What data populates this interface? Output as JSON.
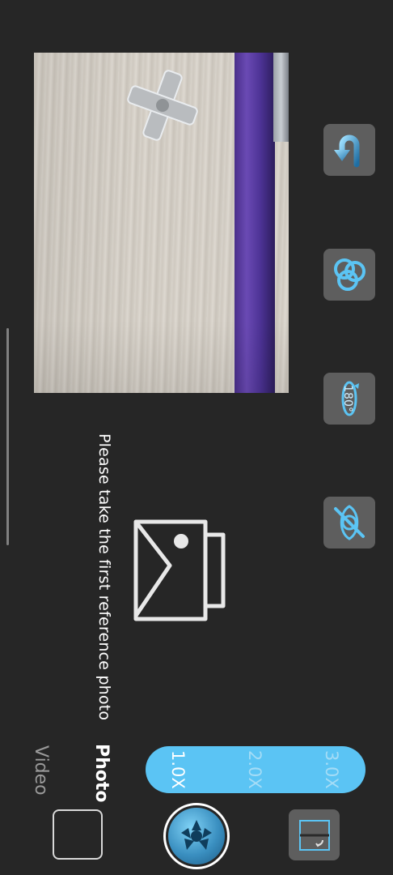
{
  "hint": {
    "text": "Please take the first reference photo"
  },
  "modes": {
    "photo": "Photo",
    "video": "Video"
  },
  "zoom": {
    "options": [
      "1.0X",
      "2.0X",
      "3.0X"
    ],
    "selected": "1.0X"
  },
  "icons": {
    "undo": "u-turn-arrow-icon",
    "filters": "overlapping-circles-icon",
    "rotate": "rotate-180-icon",
    "visibility": "eye-off-icon",
    "placeholder": "image-stack-icon",
    "shutter": "aperture-icon",
    "switch": "split-view-icon"
  },
  "colors": {
    "background": "#262626",
    "accent": "#5bc4f4",
    "tool_bg": "#5e5e5e"
  }
}
